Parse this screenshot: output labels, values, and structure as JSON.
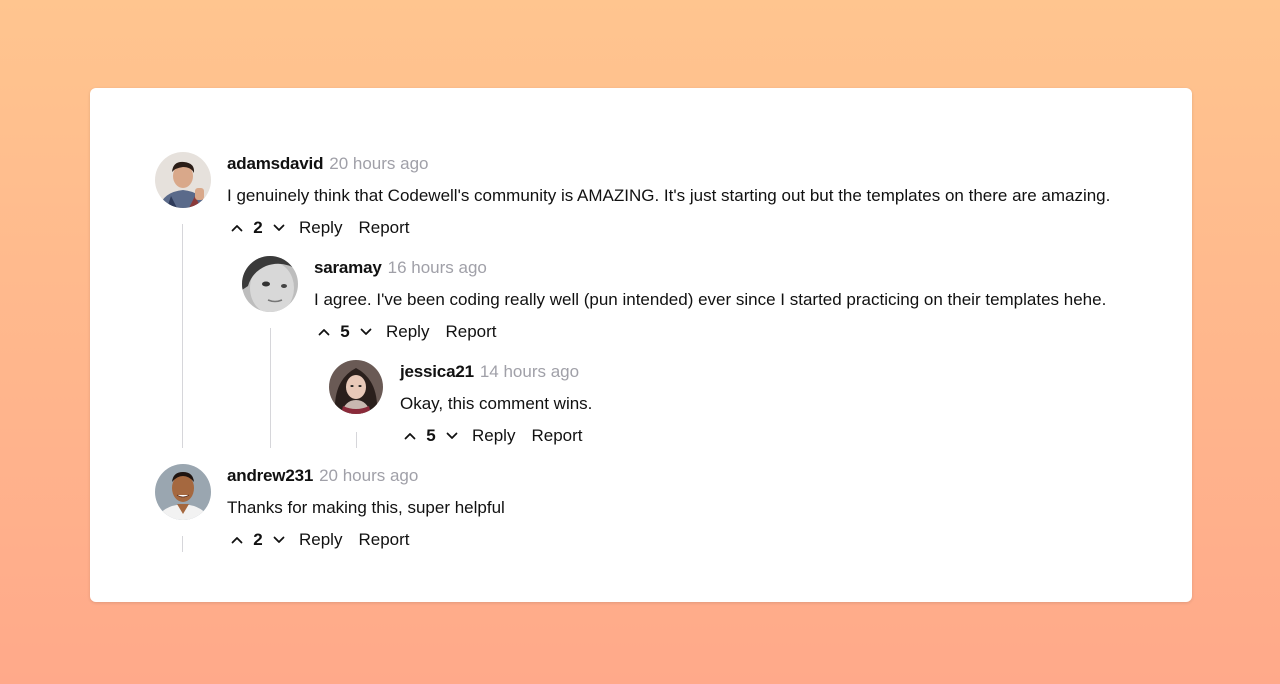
{
  "comments": [
    {
      "username": "adamsdavid",
      "time": "20 hours ago",
      "text": "I genuinely think that Codewell's community is AMAZING. It's just starting out but the templates on there are amazing.",
      "votes": "2",
      "reply": "Reply",
      "report": "Report"
    },
    {
      "username": "saramay",
      "time": "16 hours ago",
      "text": "I agree. I've been coding really well (pun intended) ever since I started practicing on their templates hehe.",
      "votes": "5",
      "reply": "Reply",
      "report": "Report"
    },
    {
      "username": "jessica21",
      "time": "14 hours ago",
      "text": "Okay, this comment wins.",
      "votes": "5",
      "reply": "Reply",
      "report": "Report"
    },
    {
      "username": "andrew231",
      "time": "20 hours ago",
      "text": "Thanks for making this, super helpful",
      "votes": "2",
      "reply": "Reply",
      "report": "Report"
    }
  ],
  "colors": {
    "background_top": "#ffc58f",
    "background_bottom": "#ffa98a",
    "card": "#ffffff",
    "timestamp": "#a0a0a8",
    "thread_line": "#d6d6da"
  },
  "icons": {
    "upvote": "chevron-up-icon",
    "downvote": "chevron-down-icon"
  }
}
